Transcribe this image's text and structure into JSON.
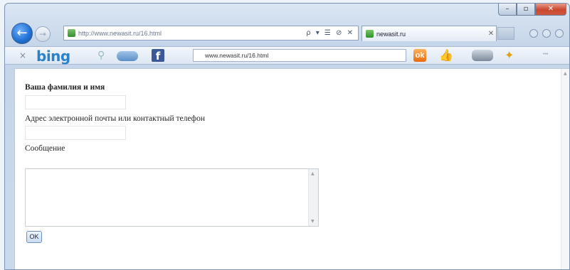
{
  "browser": {
    "address": "http://www.newasit.ru/16.html",
    "tab_title": "newasit.ru",
    "addr_tools": "ρ ▾ ☰ ⊘ ✕"
  },
  "toolbar": {
    "brand": "bing",
    "search_value": "www.newasit.ru/16.html"
  },
  "form": {
    "name_label": "Ваша фамилия и имя",
    "contact_label": "Адрес электронной почты или контактный телефон",
    "message_label": "Сообщение",
    "submit_label": "OK"
  },
  "colors": {
    "accent": "#2a82c8",
    "facebook": "#3b5998"
  }
}
